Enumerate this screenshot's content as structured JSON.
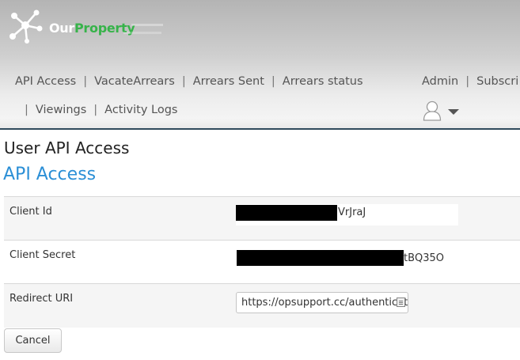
{
  "brand": {
    "name_part1": "Our",
    "name_part2": "Property",
    "accent_color": "#37b34a"
  },
  "nav": {
    "row1": [
      "API Access",
      "VacateArrears",
      "Arrears Sent",
      "Arrears status"
    ],
    "row2": [
      "Viewings",
      "Activity Logs"
    ],
    "right": [
      "Admin",
      "Subscri"
    ]
  },
  "user_menu": {
    "icon": "user-icon",
    "caret": "chevron-down-icon"
  },
  "page": {
    "title": "User API Access",
    "section_title": "API Access",
    "section_color": "#2b8fd6"
  },
  "fields": [
    {
      "label": "Client Id",
      "visible_suffix": "VrJraJ"
    },
    {
      "label": "Client Secret",
      "visible_suffix": "tBQ35O"
    },
    {
      "label": "Redirect URI",
      "value": "https://opsupport.cc/authenticate"
    }
  ],
  "actions": {
    "cancel_label": "Cancel"
  }
}
